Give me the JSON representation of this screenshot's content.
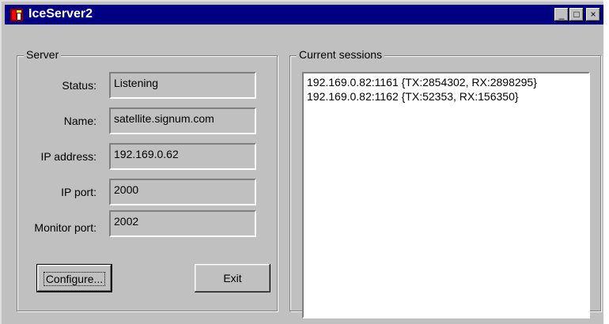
{
  "window": {
    "title": "IceServer2"
  },
  "titlebar_buttons": {
    "minimize": "_",
    "maximize": "□",
    "close": "×"
  },
  "server": {
    "group_label": "Server",
    "fields": [
      {
        "label": "Status:",
        "value": "Listening"
      },
      {
        "label": "Name:",
        "value": "satellite.signum.com"
      },
      {
        "label": "IP address:",
        "value": "192.169.0.62"
      },
      {
        "label": "IP port:",
        "value": "2000"
      },
      {
        "label": "Monitor port:",
        "value": "2002"
      }
    ],
    "configure_label": "Configure...",
    "exit_label": "Exit"
  },
  "sessions": {
    "group_label": "Current sessions",
    "items": [
      "192.169.0.82:1161 {TX:2854302, RX:2898295}",
      "192.169.0.82:1162 {TX:52353, RX:156350}"
    ]
  },
  "colors": {
    "titlebar": "#000080",
    "face": "#c0c0c0"
  },
  "icons": {
    "app": "app-icon"
  }
}
